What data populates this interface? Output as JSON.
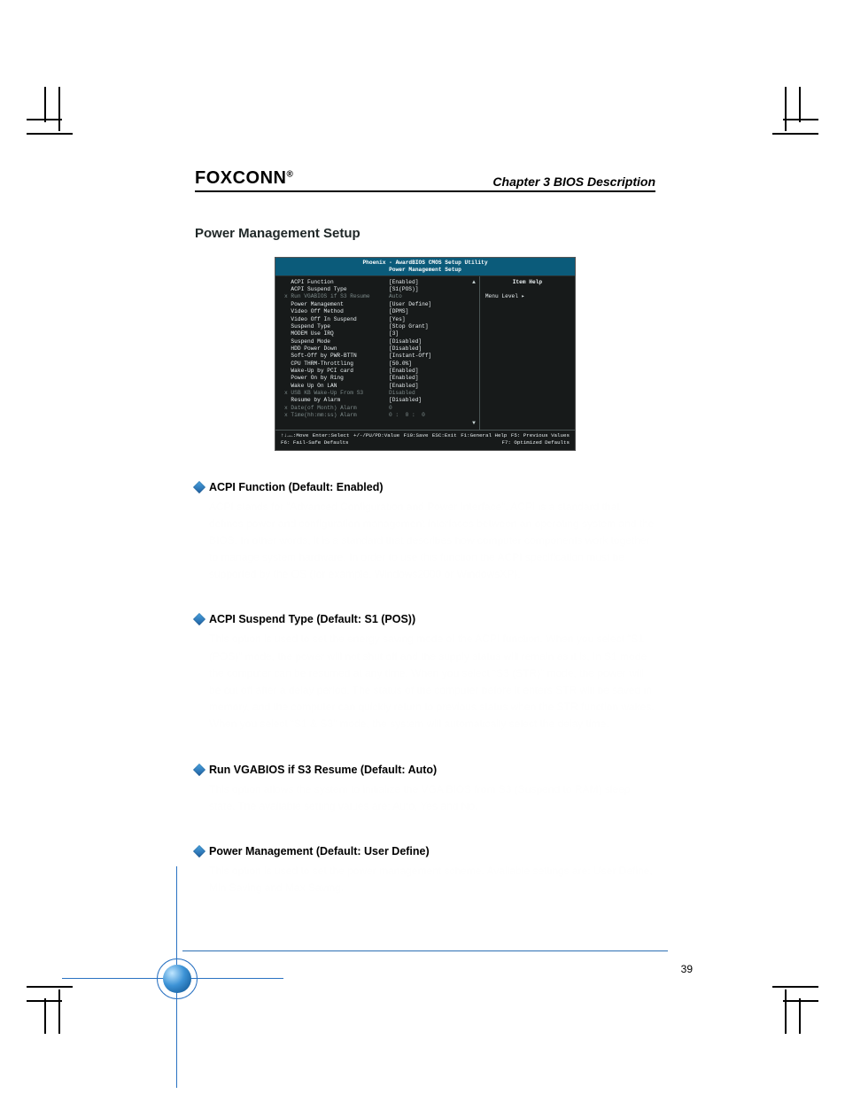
{
  "header": {
    "brand": "FOXCONN",
    "reg": "®",
    "chapter": "Chapter 3    BIOS Description"
  },
  "section_title": "Power Management Setup",
  "bios": {
    "title1": "Phoenix - AwardBIOS CMOS Setup Utility",
    "title2": "Power Management Setup",
    "help_title": "Item Help",
    "help_menu_level": "Menu Level   ▸",
    "rows": [
      {
        "label": "ACPI Function",
        "value": "[Enabled]",
        "dim": false,
        "marker": ""
      },
      {
        "label": "ACPI Suspend Type",
        "value": "[S1(POS)]",
        "dim": false,
        "marker": ""
      },
      {
        "label": "Run VGABIOS if S3 Resume",
        "value": "Auto",
        "dim": true,
        "marker": "x "
      },
      {
        "label": "Power Management",
        "value": "[User Define]",
        "dim": false,
        "marker": ""
      },
      {
        "label": "Video Off Method",
        "value": "[DPMS]",
        "dim": false,
        "marker": ""
      },
      {
        "label": "Video Off In Suspend",
        "value": "[Yes]",
        "dim": false,
        "marker": ""
      },
      {
        "label": "Suspend Type",
        "value": "[Stop Grant]",
        "dim": false,
        "marker": ""
      },
      {
        "label": "MODEM Use IRQ",
        "value": "[3]",
        "dim": false,
        "marker": ""
      },
      {
        "label": "Suspend Mode",
        "value": "[Disabled]",
        "dim": false,
        "marker": ""
      },
      {
        "label": "HDD Power Down",
        "value": "[Disabled]",
        "dim": false,
        "marker": ""
      },
      {
        "label": "Soft-Off by PWR-BTTN",
        "value": "[Instant-Off]",
        "dim": false,
        "marker": ""
      },
      {
        "label": "CPU THRM-Throttling",
        "value": "[50.0%]",
        "dim": false,
        "marker": ""
      },
      {
        "label": "Wake-Up by PCI card",
        "value": "[Enabled]",
        "dim": false,
        "marker": ""
      },
      {
        "label": "Power On by Ring",
        "value": "[Enabled]",
        "dim": false,
        "marker": ""
      },
      {
        "label": "Wake Up On LAN",
        "value": "[Enabled]",
        "dim": false,
        "marker": ""
      },
      {
        "label": "USB KB Wake-Up From S3",
        "value": "Disabled",
        "dim": true,
        "marker": "x "
      },
      {
        "label": "Resume by Alarm",
        "value": "[Disabled]",
        "dim": false,
        "marker": ""
      },
      {
        "label": "Date(of Month) Alarm",
        "value": "0",
        "dim": true,
        "marker": "x "
      },
      {
        "label": "Time(hh:mm:ss) Alarm",
        "value": "0 :  0 :  0",
        "dim": true,
        "marker": "x "
      }
    ],
    "scroll_up": "▲",
    "scroll_dn": "▼",
    "footer": {
      "f_move": "↑↓→←:Move",
      "f_enter": "Enter:Select",
      "f_val": "+/-/PU/PD:Value",
      "f_save": "F10:Save",
      "f_esc": "ESC:Exit",
      "f_help": "F1:General Help",
      "f_prev": "F5: Previous Values",
      "f_fail": "F6: Fail-Safe Defaults",
      "f_opt": "F7: Optimized Defaults"
    }
  },
  "items": [
    {
      "title": "ACPI Function (Default: Enabled)",
      "body": [
        "ACPI stands for “Advanced Configuration and Power Interface”. ACPI is a standard that defines power and configuration management interfaces between an operating system and the BIOS. In other words, it is a standard that describes how computer components work together to manage system hardware. In order to use this function the ACPI specification must be supported by the OS (for example, Windows2000 or WindowsXP)."
      ]
    },
    {
      "title": "ACPI Suspend Type (Default: S1 (POS))",
      "body": [
        "This option is used to set the energy saving mode of the ACPI function. When you select “S1 (POS)” mode, the power will not shut off and the supply status will remain as it is, in S1 mode the computer can be resumed at any time. When you select “S3 (STR)” mode, the power will be cut off after a delay period. The status of the computer before it enters STR will be saved in memory, and the computer can quickly return to previous status when the STR function wakes. When you select “S1 & S3” mode, the system will automatically select the delay time."
      ]
    },
    {
      "title": "Run VGABIOS if S3 Resume (Default: Auto)",
      "body": [
        "This option allows the system to initialize the VGA BIOS from S3 (Suspend to RAM) sleep state. The available setting values are: Auto, Yes and No."
      ]
    },
    {
      "title": "Power Management (Default: User Define)",
      "body": [
        "This option is used to set the power management scheme. Available settings are: User Define, Min Saving and Max Saving."
      ]
    }
  ],
  "page_number": "39"
}
